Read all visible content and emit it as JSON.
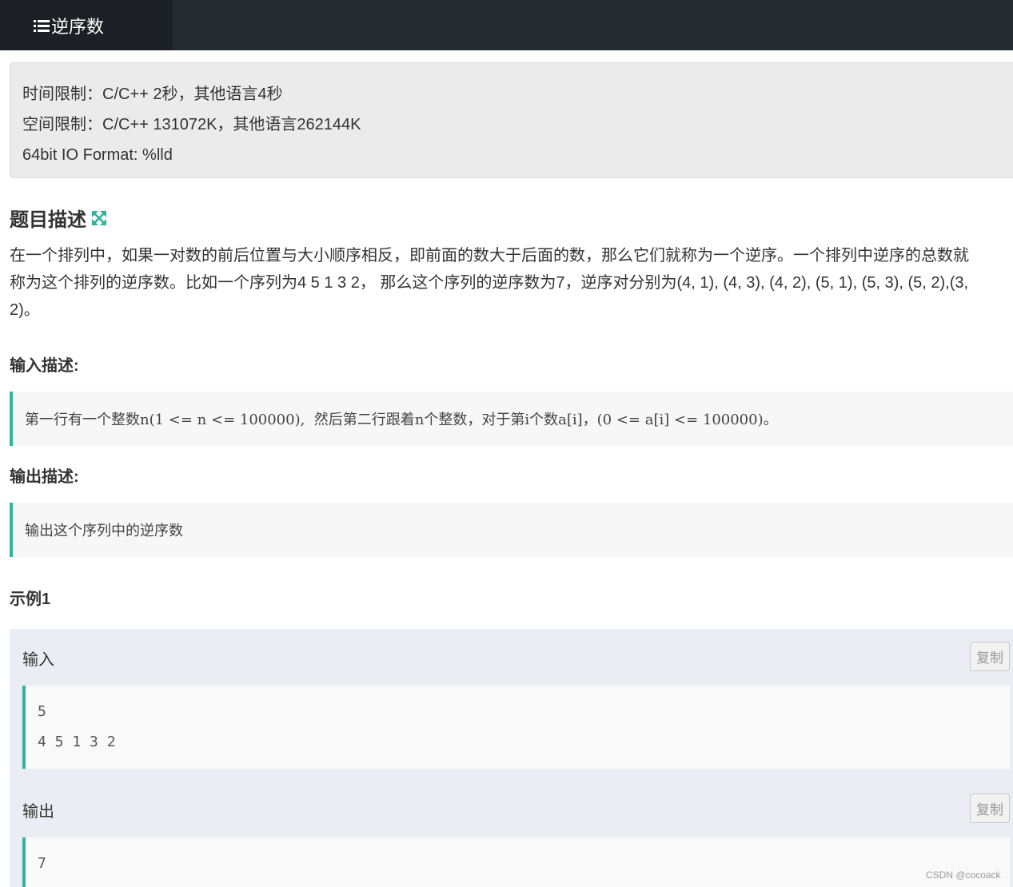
{
  "header": {
    "tab_label": "逆序数"
  },
  "limits": {
    "time": "时间限制：C/C++ 2秒，其他语言4秒",
    "space": "空间限制：C/C++ 131072K，其他语言262144K",
    "io_format": "64bit IO Format: %lld"
  },
  "problem": {
    "title": "题目描述",
    "desc_line1": "在一个排列中，如果一对数的前后位置与大小顺序相反，即前面的数大于后面的数，那么它们就称为一个逆序。一个排列中逆序的总数就",
    "desc_line2": "称为这个排列的逆序数。比如一个序列为4 5 1 3 2， 那么这个序列的逆序数为7，逆序对分别为(4, 1), (4, 3), (4, 2), (5, 1), (5, 3), (5, 2),(3,",
    "desc_line3": "2)。",
    "input_title": "输入描述:",
    "input_desc": "第一行有一个整数n(1 <= n <= 100000),  然后第二行跟着n个整数，对于第i个数a[i]，(0 <= a[i] <= 100000)。",
    "output_title": "输出描述:",
    "output_desc": "输出这个序列中的逆序数"
  },
  "example": {
    "title": "示例1",
    "input_label": "输入",
    "input_lines": [
      "5",
      "4 5 1 3 2"
    ],
    "output_label": "输出",
    "output_lines": [
      "7"
    ],
    "copy_label": "复制"
  },
  "watermark": "CSDN @cocoack",
  "colors": {
    "accent": "#32b39b",
    "topbar": "#252a2f",
    "topbar_tab": "#1c2024"
  }
}
